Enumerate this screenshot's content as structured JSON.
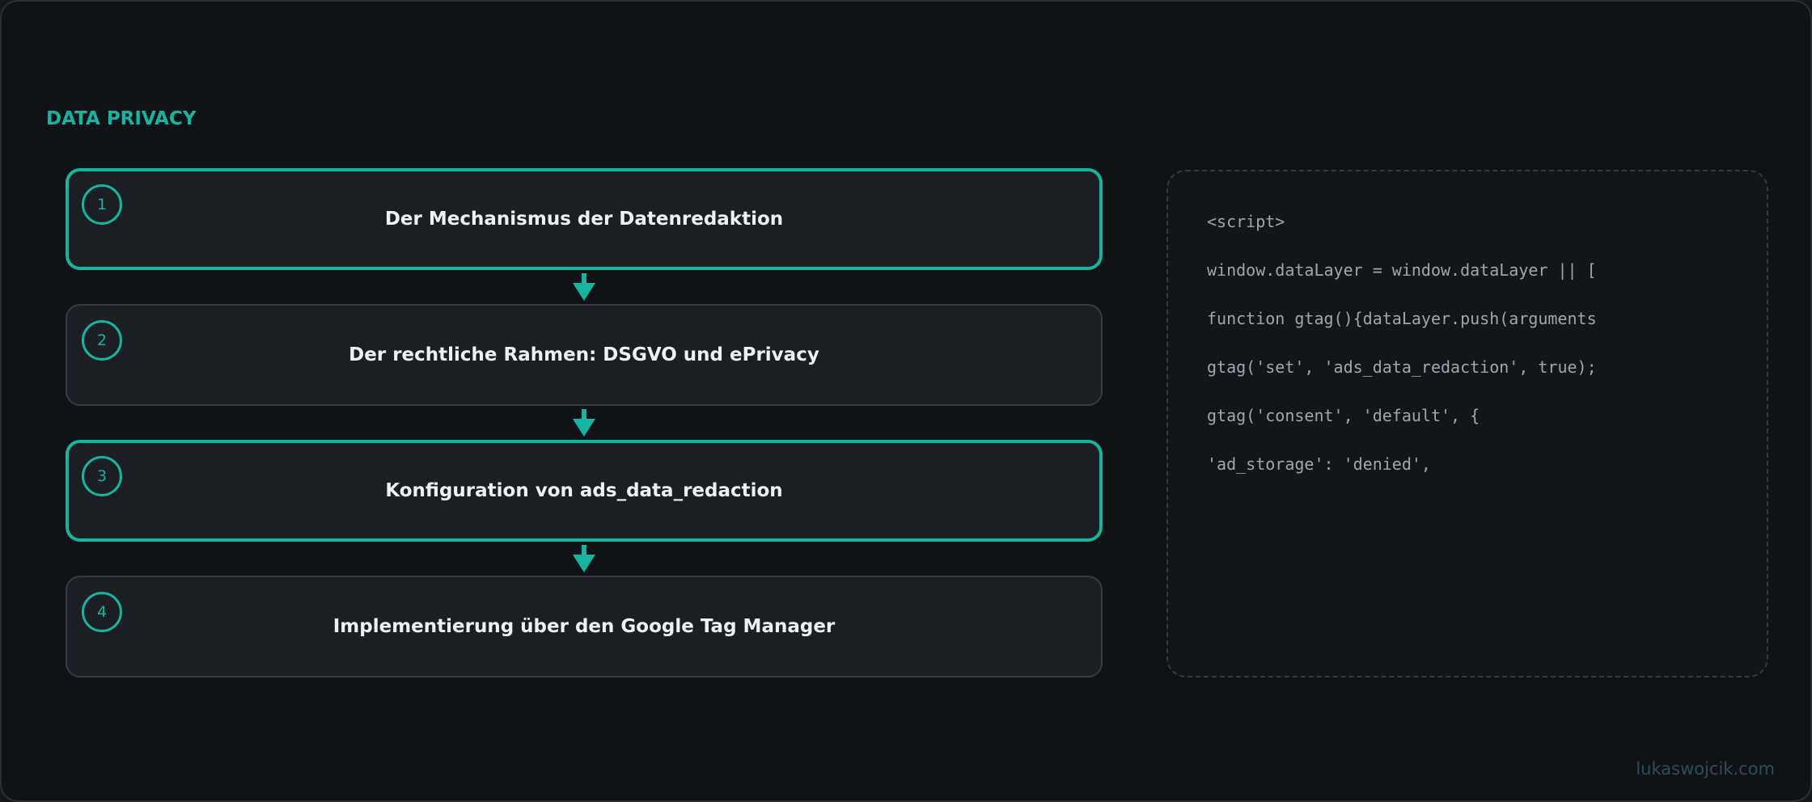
{
  "section_label": "DATA PRIVACY",
  "accent_color": "#19b3a1",
  "steps": [
    {
      "number": "1",
      "title": "Der Mechanismus der Datenredaktion",
      "highlighted": true
    },
    {
      "number": "2",
      "title": "Der rechtliche Rahmen: DSGVO und ePrivacy",
      "highlighted": false
    },
    {
      "number": "3",
      "title": "Konfiguration von ads_data_redaction",
      "highlighted": true
    },
    {
      "number": "4",
      "title": "Implementierung über den Google Tag Manager",
      "highlighted": false
    }
  ],
  "connector_icon": "arrow-down-icon",
  "code_lines": [
    "<script>",
    "window.dataLayer = window.dataLayer || [",
    "function gtag(){dataLayer.push(arguments",
    "gtag('set', 'ads_data_redaction', true);",
    "gtag('consent', 'default', {",
    "'ad_storage': 'denied',"
  ],
  "watermark": "lukaswojcik.com"
}
